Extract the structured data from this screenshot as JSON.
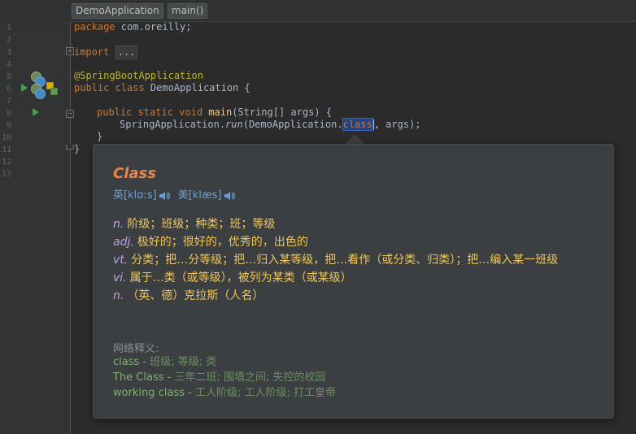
{
  "breadcrumb": [
    "DemoApplication",
    "main()"
  ],
  "line_numbers": [
    "1",
    "2",
    "3",
    "4",
    "5",
    "6",
    "7",
    "8",
    "9",
    "10",
    "11",
    "12",
    "13"
  ],
  "code": {
    "l1_kw": "package",
    "l1_rest": " com.oreilly;",
    "l3_kw": "import",
    "l3_dots": "...",
    "l5_ann": "@SpringBootApplication",
    "l6_kw": "public class",
    "l6_rest": " DemoApplication {",
    "l8_kw": "public static void",
    "l8_fn": "main",
    "l8_rest": "(String[] args) {",
    "l9_pre": "SpringApplication.",
    "l9_run": "run",
    "l9_mid": "(DemoApplication.",
    "l9_sel": "class",
    "l9_post": ", args);",
    "l10": "}",
    "l11": "}"
  },
  "popup": {
    "word": "Class",
    "phonetic_uk": "英[klɑːs]",
    "phonetic_us": "美[klæs]",
    "definitions": [
      {
        "pos": "n.",
        "text": "阶级；班级；种类；班；等级"
      },
      {
        "pos": "adj.",
        "text": "极好的；很好的，优秀的，出色的"
      },
      {
        "pos": "vt.",
        "text": "分类；把…分等级；把…归入某等级，把…看作（或分类、归类）；把…编入某一班级"
      },
      {
        "pos": "vi.",
        "text": "属于…类（或等级），被列为某类（或某级）"
      },
      {
        "pos": "n.",
        "text": "（英、德）克拉斯（人名）"
      }
    ],
    "net_title": "网络释义:",
    "net": [
      {
        "term": "class",
        "def": "班级; 等级; 类"
      },
      {
        "term": "The Class",
        "def": "三年二班; 围墙之间; 失控的校园"
      },
      {
        "term": "working class",
        "def": "工人阶级; 工人阶级; 打工皇帝"
      }
    ],
    "net_separator": " - "
  },
  "icons": [
    "run-icon",
    "spring-bean-icon",
    "speaker-icon",
    "fold-icon"
  ],
  "colors": {
    "keyword": "#cc7832",
    "annotation": "#bbb529",
    "title": "#e8854b",
    "definition": "#f0c65b",
    "pos": "#c49ee6"
  }
}
